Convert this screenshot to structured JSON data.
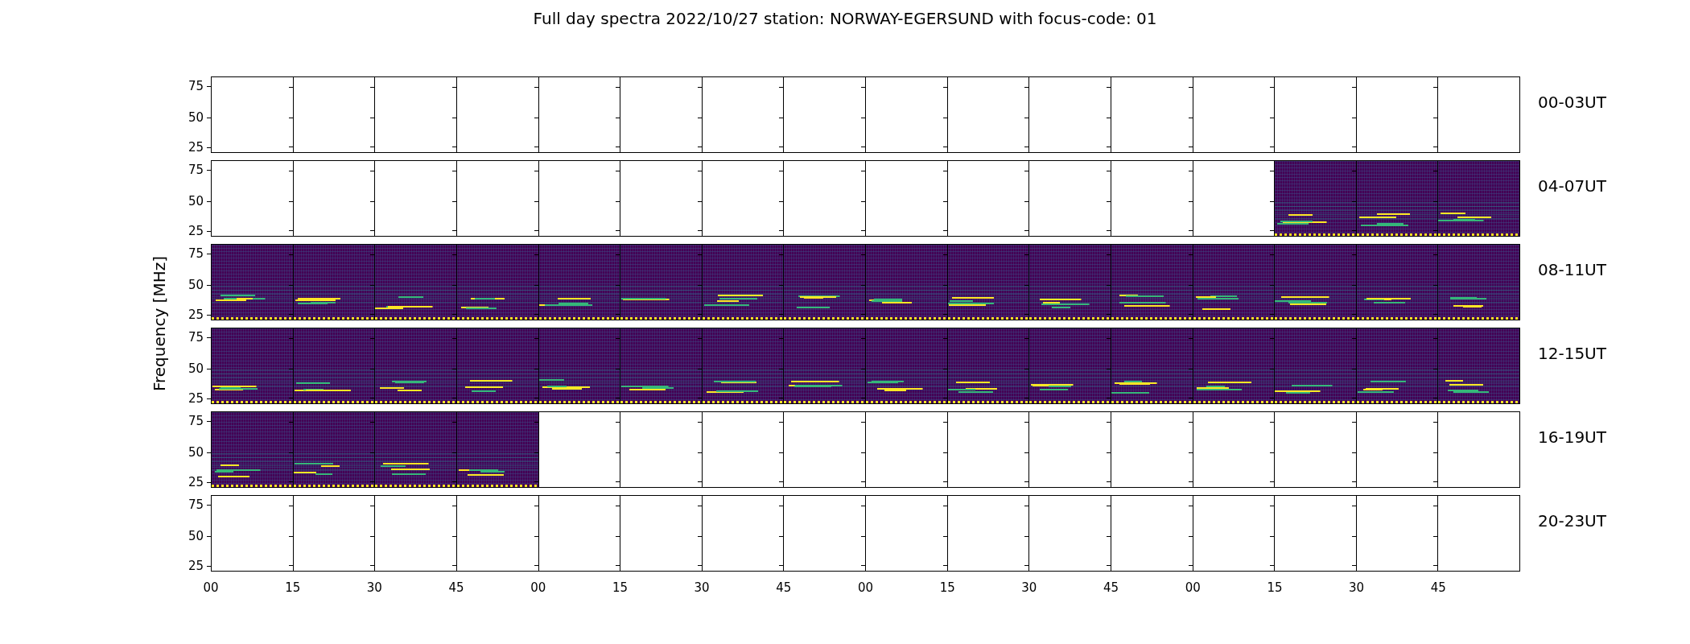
{
  "title": "Full day spectra 2022/10/27 station: NORWAY-EGERSUND with focus-code: 01",
  "ylabel": "Frequency [MHz]",
  "xticks": [
    "00",
    "15",
    "30",
    "45",
    "00",
    "15",
    "30",
    "45",
    "00",
    "15",
    "30",
    "45",
    "00",
    "15",
    "30",
    "45"
  ],
  "rows": [
    {
      "label": "00-03UT",
      "yticks": [
        "75",
        "50",
        "25"
      ],
      "panels": [
        {
          "has_data": false
        },
        {
          "has_data": false
        },
        {
          "has_data": false
        },
        {
          "has_data": false
        },
        {
          "has_data": false
        },
        {
          "has_data": false
        },
        {
          "has_data": false
        },
        {
          "has_data": false
        },
        {
          "has_data": false
        },
        {
          "has_data": false
        },
        {
          "has_data": false
        },
        {
          "has_data": false
        },
        {
          "has_data": false
        },
        {
          "has_data": false
        },
        {
          "has_data": false
        },
        {
          "has_data": false
        }
      ]
    },
    {
      "label": "04-07UT",
      "yticks": [
        "75",
        "50",
        "25"
      ],
      "panels": [
        {
          "has_data": false
        },
        {
          "has_data": false
        },
        {
          "has_data": false
        },
        {
          "has_data": false
        },
        {
          "has_data": false
        },
        {
          "has_data": false
        },
        {
          "has_data": false
        },
        {
          "has_data": false
        },
        {
          "has_data": false
        },
        {
          "has_data": false
        },
        {
          "has_data": false
        },
        {
          "has_data": false
        },
        {
          "has_data": false
        },
        {
          "has_data": true
        },
        {
          "has_data": true
        },
        {
          "has_data": true
        }
      ]
    },
    {
      "label": "08-11UT",
      "yticks": [
        "75",
        "50",
        "25"
      ],
      "panels": [
        {
          "has_data": true
        },
        {
          "has_data": true
        },
        {
          "has_data": true
        },
        {
          "has_data": true
        },
        {
          "has_data": true
        },
        {
          "has_data": true
        },
        {
          "has_data": true
        },
        {
          "has_data": true
        },
        {
          "has_data": true
        },
        {
          "has_data": true
        },
        {
          "has_data": true
        },
        {
          "has_data": true
        },
        {
          "has_data": true
        },
        {
          "has_data": true
        },
        {
          "has_data": true
        },
        {
          "has_data": true
        }
      ]
    },
    {
      "label": "12-15UT",
      "yticks": [
        "75",
        "50",
        "25"
      ],
      "panels": [
        {
          "has_data": true
        },
        {
          "has_data": true
        },
        {
          "has_data": true
        },
        {
          "has_data": true
        },
        {
          "has_data": true
        },
        {
          "has_data": true
        },
        {
          "has_data": true
        },
        {
          "has_data": true
        },
        {
          "has_data": true
        },
        {
          "has_data": true
        },
        {
          "has_data": true
        },
        {
          "has_data": true
        },
        {
          "has_data": true
        },
        {
          "has_data": true
        },
        {
          "has_data": true
        },
        {
          "has_data": true
        }
      ]
    },
    {
      "label": "16-19UT",
      "yticks": [
        "75",
        "50",
        "25"
      ],
      "panels": [
        {
          "has_data": true
        },
        {
          "has_data": true
        },
        {
          "has_data": true
        },
        {
          "has_data": true
        },
        {
          "has_data": false
        },
        {
          "has_data": false
        },
        {
          "has_data": false
        },
        {
          "has_data": false
        },
        {
          "has_data": false
        },
        {
          "has_data": false
        },
        {
          "has_data": false
        },
        {
          "has_data": false
        },
        {
          "has_data": false
        },
        {
          "has_data": false
        },
        {
          "has_data": false
        },
        {
          "has_data": false
        }
      ]
    },
    {
      "label": "20-23UT",
      "yticks": [
        "75",
        "50",
        "25"
      ],
      "panels": [
        {
          "has_data": false
        },
        {
          "has_data": false
        },
        {
          "has_data": false
        },
        {
          "has_data": false
        },
        {
          "has_data": false
        },
        {
          "has_data": false
        },
        {
          "has_data": false
        },
        {
          "has_data": false
        },
        {
          "has_data": false
        },
        {
          "has_data": false
        },
        {
          "has_data": false
        },
        {
          "has_data": false
        },
        {
          "has_data": false
        },
        {
          "has_data": false
        },
        {
          "has_data": false
        },
        {
          "has_data": false
        }
      ]
    }
  ]
}
